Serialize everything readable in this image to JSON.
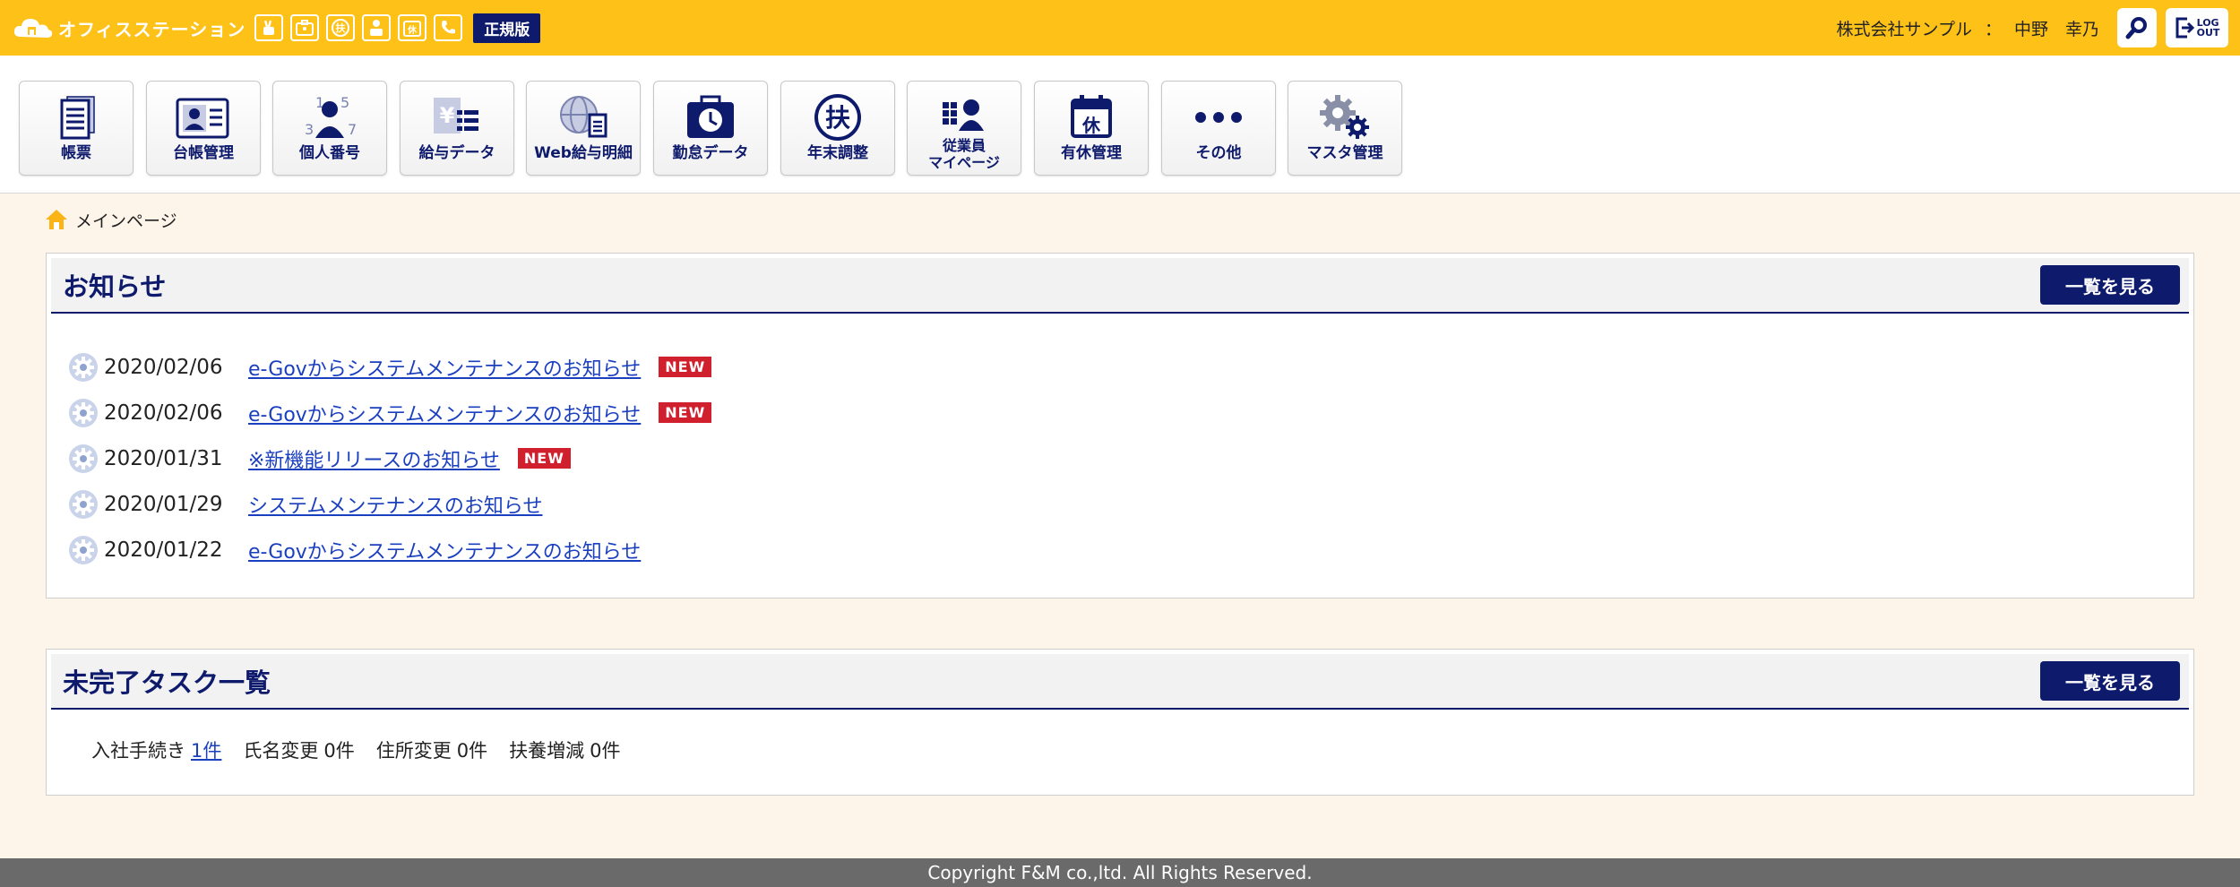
{
  "header": {
    "brand_name": "オフィスステーション",
    "mini_icons": [
      {
        "name": "rabbit-icon",
        "glyph": "🐇"
      },
      {
        "name": "briefcase-icon",
        "glyph": "▣"
      },
      {
        "name": "fu-icon",
        "glyph": "扶"
      },
      {
        "name": "my-icon",
        "glyph": "⋮"
      },
      {
        "name": "kyu-icon",
        "glyph": "休"
      },
      {
        "name": "phone-icon",
        "glyph": "✆"
      }
    ],
    "edition": "正規版",
    "company": "株式会社サンプル",
    "colon": "：",
    "user": "中野　幸乃",
    "logout_label_1": "LOG",
    "logout_label_2": "OUT"
  },
  "nav": {
    "items": [
      {
        "label": "帳票"
      },
      {
        "label": "台帳管理"
      },
      {
        "label": "個人番号"
      },
      {
        "label": "給与データ"
      },
      {
        "label": "Web給与明細"
      },
      {
        "label": "勤怠データ"
      },
      {
        "label": "年末調整"
      },
      {
        "label_1": "従業員",
        "label_2": "マイページ"
      },
      {
        "label": "有休管理"
      },
      {
        "label": "その他"
      },
      {
        "label": "マスタ管理"
      }
    ]
  },
  "breadcrumb": {
    "label": "メインページ"
  },
  "news": {
    "title": "お知らせ",
    "more_label": "一覧を見る",
    "new_label": "NEW",
    "items": [
      {
        "date": "2020/02/06",
        "text": "e-Govからシステムメンテナンスのお知らせ",
        "is_new": true
      },
      {
        "date": "2020/02/06",
        "text": "e-Govからシステムメンテナンスのお知らせ",
        "is_new": true
      },
      {
        "date": "2020/01/31",
        "text": "※新機能リリースのお知らせ",
        "is_new": true
      },
      {
        "date": "2020/01/29",
        "text": "システムメンテナンスのお知らせ",
        "is_new": false
      },
      {
        "date": "2020/01/22",
        "text": "e-Govからシステムメンテナンスのお知らせ",
        "is_new": false
      }
    ]
  },
  "tasks": {
    "title": "未完了タスク一覧",
    "more_label": "一覧を見る",
    "items": [
      {
        "label": "入社手続き",
        "count": "1件",
        "is_link": true
      },
      {
        "label": "氏名変更",
        "count": "0件",
        "is_link": false
      },
      {
        "label": "住所変更",
        "count": "0件",
        "is_link": false
      },
      {
        "label": "扶養増減",
        "count": "0件",
        "is_link": false
      }
    ]
  },
  "footer": {
    "copyright": "Copyright F&M co.,ltd. All Rights Reserved."
  },
  "colors": {
    "header_bg": "#fdc118",
    "navy": "#0e1a6c",
    "link": "#1a3fbf",
    "new_badge": "#d0202e",
    "page_bg": "#fdf5ea",
    "footer_bg": "#6a6a6a"
  }
}
